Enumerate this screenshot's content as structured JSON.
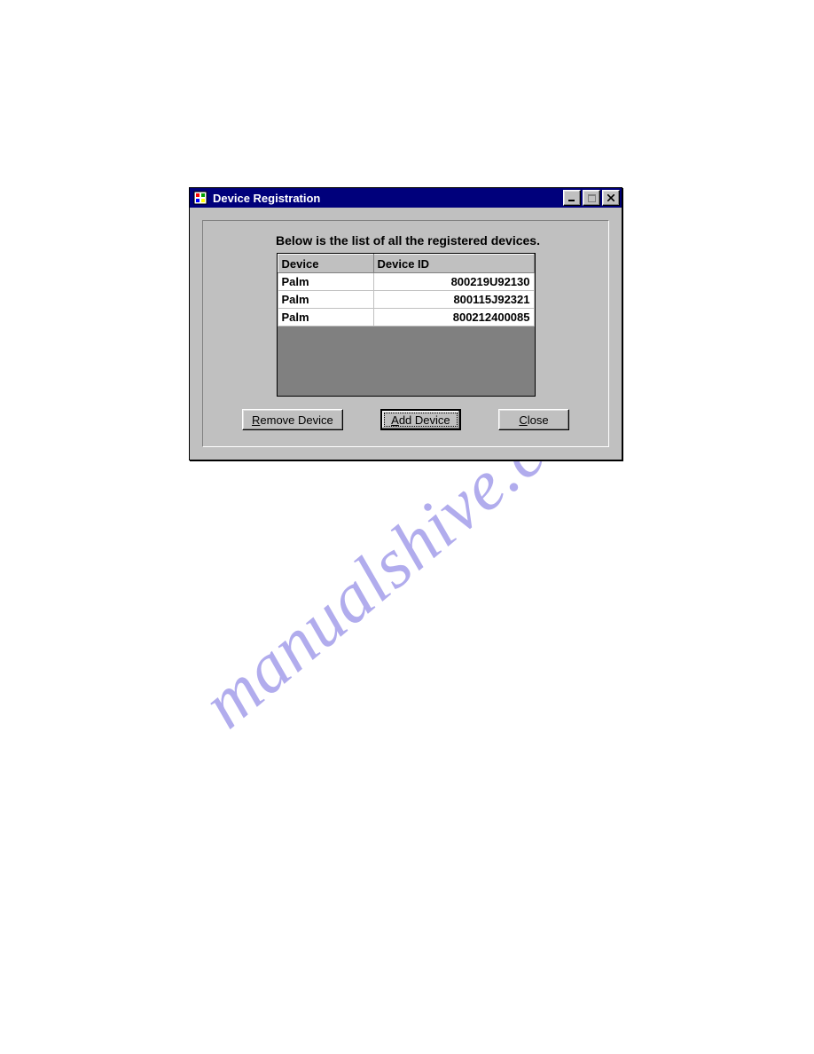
{
  "watermark": "manualshive.com",
  "window": {
    "title": "Device Registration",
    "heading": "Below is the list of all the registered devices.",
    "columns": {
      "device": "Device",
      "device_id": "Device ID"
    },
    "rows": [
      {
        "device": "Palm",
        "device_id": "800219U92130"
      },
      {
        "device": "Palm",
        "device_id": "800115J92321"
      },
      {
        "device": "Palm",
        "device_id": "800212400085"
      }
    ],
    "buttons": {
      "remove": {
        "pre": "R",
        "rest": "emove Device"
      },
      "add": {
        "pre": "A",
        "rest": "dd Device"
      },
      "close": {
        "pre": "C",
        "rest": "lose"
      }
    }
  }
}
